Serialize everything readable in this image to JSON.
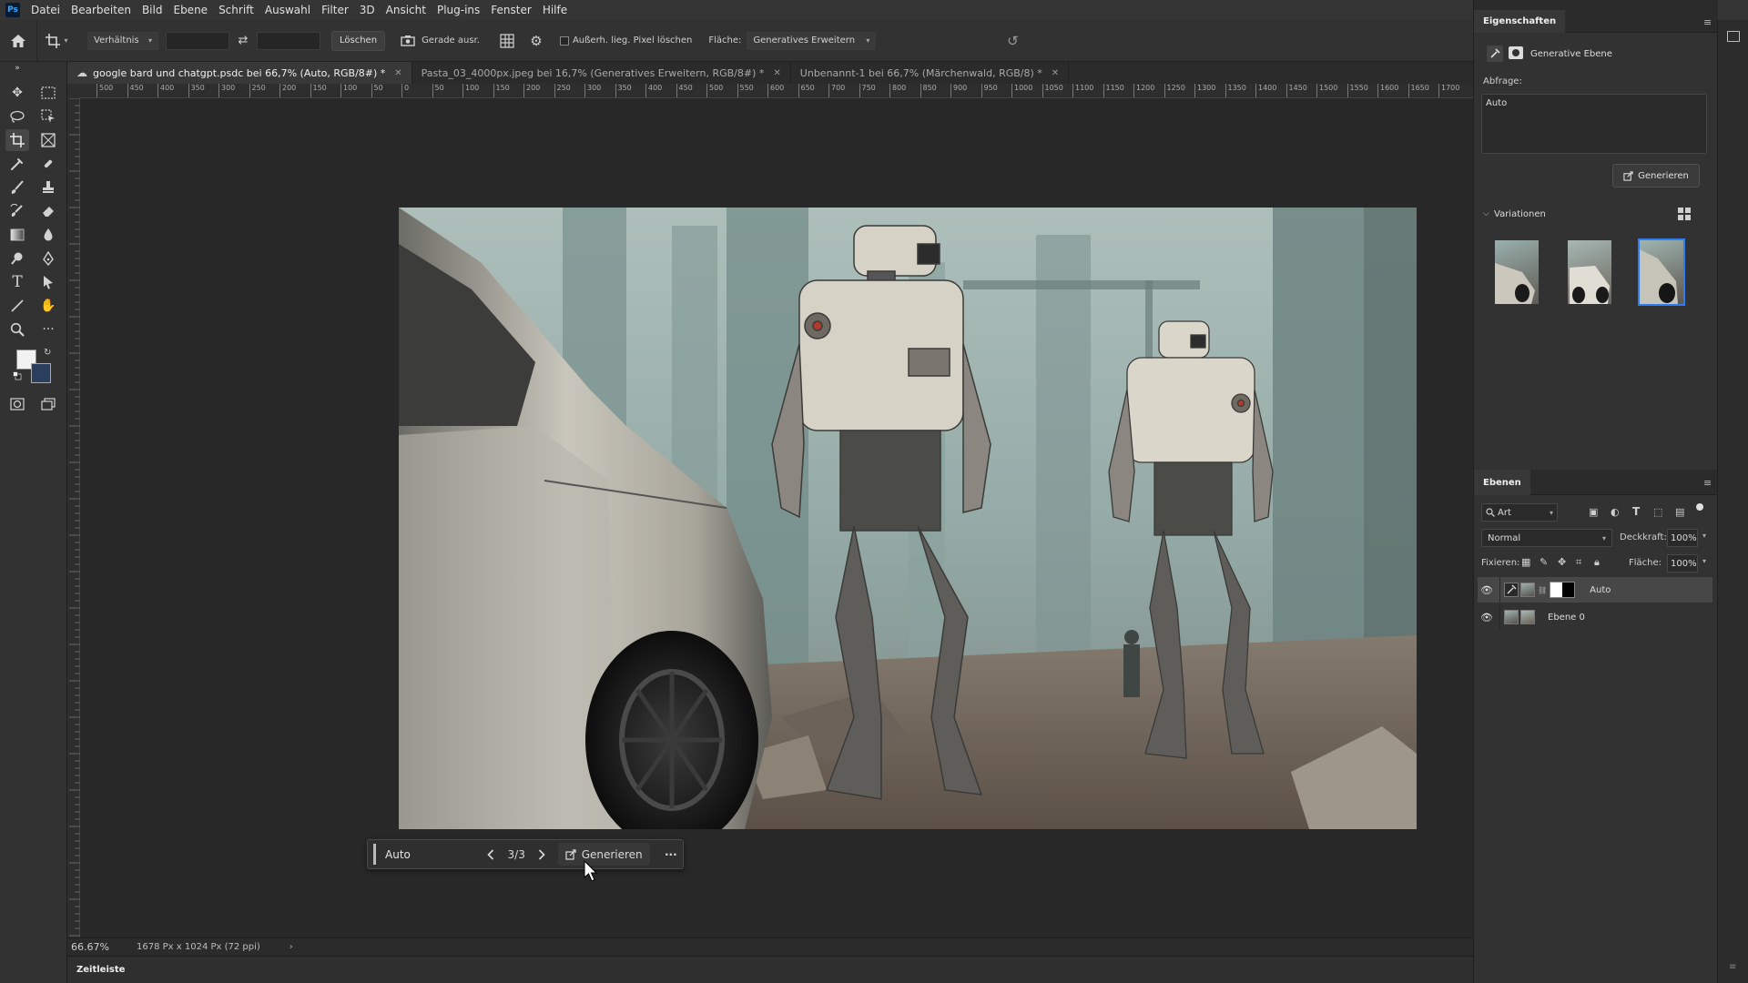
{
  "app": {
    "logo": "Ps"
  },
  "menu": [
    "Datei",
    "Bearbeiten",
    "Bild",
    "Ebene",
    "Schrift",
    "Auswahl",
    "Filter",
    "3D",
    "Ansicht",
    "Plug-ins",
    "Fenster",
    "Hilfe"
  ],
  "options": {
    "ratio_label": "Verhältnis",
    "clear_label": "Löschen",
    "straighten_label": "Gerade ausr.",
    "delete_pixels_label": "Außerh. lieg. Pixel löschen",
    "fill_label": "Fläche:",
    "fill_value": "Generatives Erweitern"
  },
  "tabs": [
    {
      "label": "google bard und chatgpt.psdc bei 66,7% (Auto, RGB/8#) *",
      "active": true
    },
    {
      "label": "Pasta_03_4000px.jpeg bei 16,7% (Generatives Erweitern, RGB/8#) *",
      "active": false
    },
    {
      "label": "Unbenannt-1 bei 66,7% (Märchenwald, RGB/8) *",
      "active": false
    }
  ],
  "ruler": {
    "top_ticks": [
      "500",
      "450",
      "400",
      "350",
      "300",
      "250",
      "200",
      "150",
      "100",
      "50",
      "0",
      "50",
      "100",
      "150",
      "200",
      "250",
      "300",
      "350",
      "400",
      "450",
      "500",
      "550",
      "600",
      "650",
      "700",
      "750",
      "800",
      "850",
      "900",
      "950",
      "1000",
      "1050",
      "1100",
      "1150",
      "1200",
      "1250",
      "1300",
      "1350",
      "1400",
      "1450",
      "1500",
      "1550",
      "1600",
      "1650",
      "1700"
    ]
  },
  "context_bar": {
    "prompt_value": "Auto",
    "counter": "3/3",
    "generate_label": "Generieren",
    "more_label": "···"
  },
  "status": {
    "zoom": "66.67%",
    "doc_info": "1678 Px x 1024 Px (72 ppi)"
  },
  "timeline": {
    "label": "Zeitleiste"
  },
  "properties": {
    "tab_label": "Eigenschaften",
    "layer_type": "Generative Ebene",
    "prompt_label": "Abfrage:",
    "prompt_value": "Auto",
    "generate_label": "Generieren",
    "variations_label": "Variationen",
    "selected_variation": 3
  },
  "layers": {
    "tab_label": "Ebenen",
    "filter_label": "Art",
    "blend_mode": "Normal",
    "opacity_label": "Deckkraft:",
    "opacity_value": "100%",
    "lock_label": "Fixieren:",
    "fill_label": "Fläche:",
    "fill_value": "100%",
    "items": [
      {
        "name": "Auto",
        "visible": true,
        "selected": true
      },
      {
        "name": "Ebene 0",
        "visible": true,
        "selected": false
      }
    ]
  },
  "colors": {
    "accent": "#2e7cf6",
    "panel_bg": "#323232",
    "canvas_bg": "#282828"
  }
}
